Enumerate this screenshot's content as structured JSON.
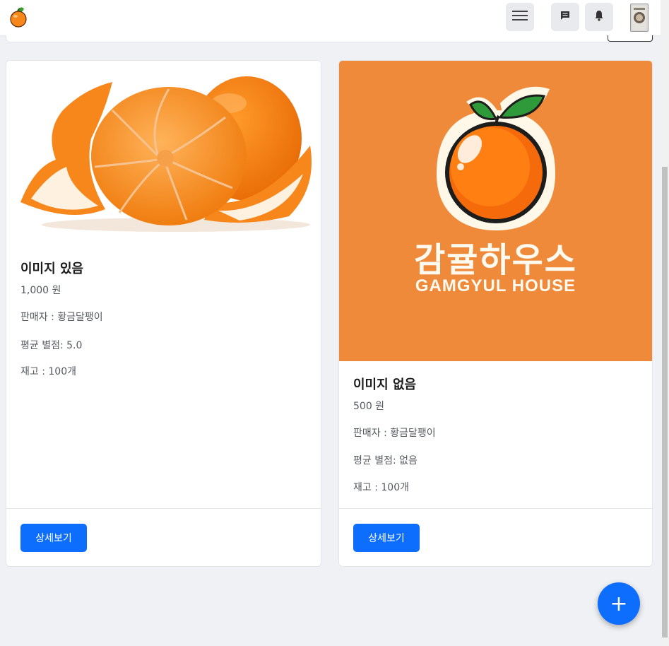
{
  "header": {
    "logo_icon": "tangerine-icon",
    "menu_icon": "hamburger-icon",
    "chat_icon": "chat-bubble-icon",
    "notification_icon": "bell-icon",
    "avatar_icon": "profile-avatar"
  },
  "products": [
    {
      "title": "이미지 있음",
      "price": "1,000 원",
      "seller": "판매자 : 황금달팽이",
      "rating": "평균 별점: 5.0",
      "stock": "재고 : 100개",
      "detail_button": "상세보기",
      "image": "peeled-tangerine-photo"
    },
    {
      "title": "이미지 없음",
      "price": "500 원",
      "seller": "판매자 : 황금달팽이",
      "rating": "평균 별점: 없음",
      "stock": "재고 : 100개",
      "detail_button": "상세보기",
      "image": "gamgyul-house-logo",
      "logo_text_ko": "감귤하우스",
      "logo_text_en": "GAMGYUL HOUSE"
    }
  ],
  "fab": {
    "label": "+",
    "icon": "plus-icon"
  },
  "colors": {
    "primary": "#0d6efd",
    "background": "#f0f1f4",
    "brand_orange": "#ee8a3a"
  }
}
